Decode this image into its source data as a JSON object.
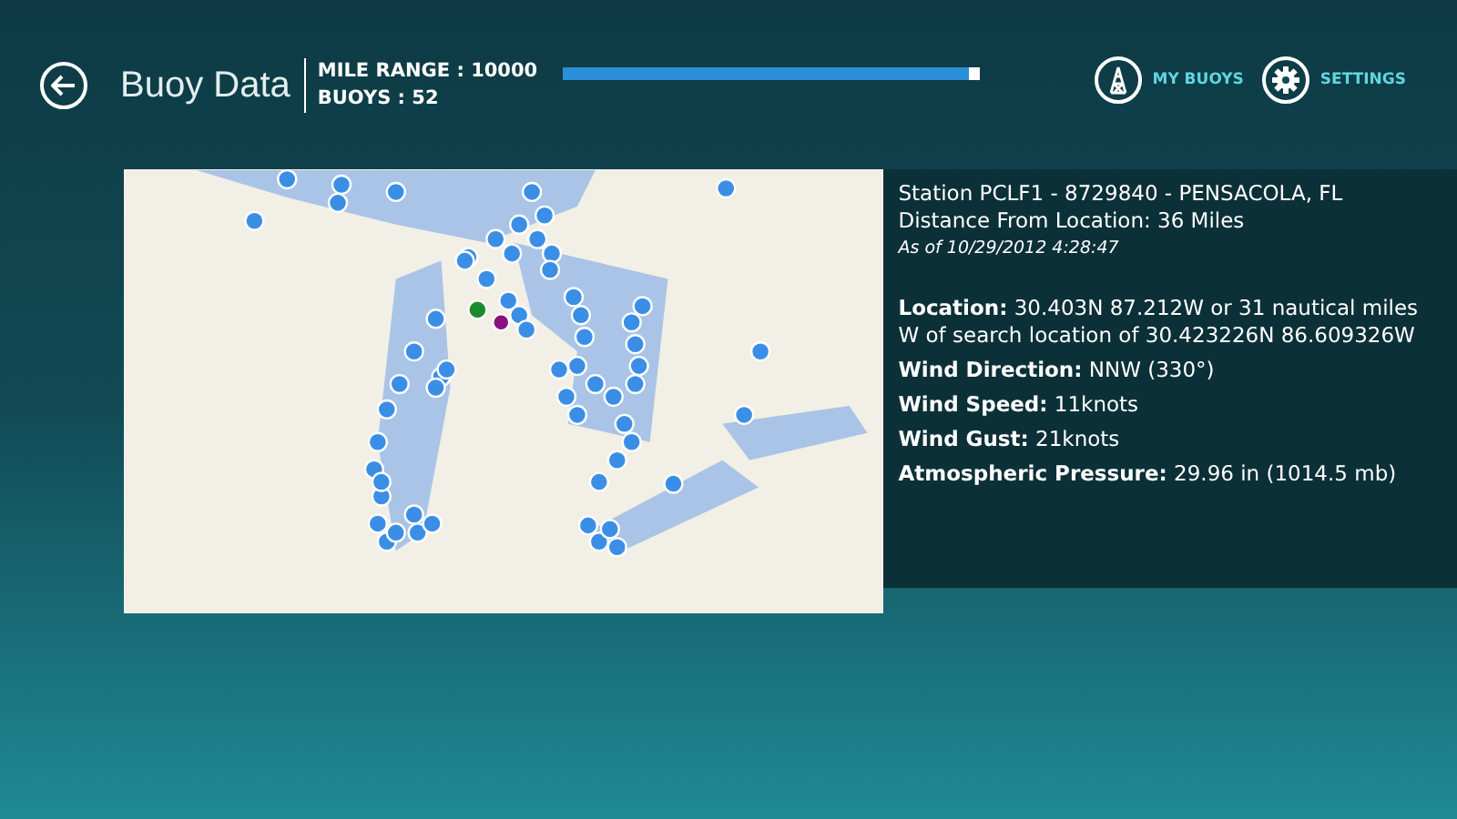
{
  "header": {
    "title": "Buoy Data",
    "mile_range": "MILE RANGE : 10000",
    "buoys": "BUOYS : 52",
    "range_slider": {
      "level": 0.99
    }
  },
  "actions": [
    {
      "kind": "buoy",
      "label": "MY BUOYS"
    },
    {
      "kind": "settings",
      "label": "SETTINGS"
    }
  ],
  "station": {
    "title": "Station PCLF1 - 8729840 - PENSACOLA, FL",
    "distance": "Distance From Location: 36 Miles",
    "timestamp": "As of 10/29/2012 4:28:47",
    "details": [
      "**Location:** 30.403N 87.212W or 31 nautical miles W of search location of 30.423226N 86.609326W",
      "**Wind Direction:** NNW (330°)",
      "**Wind Speed:** 11knots",
      "**Wind Gust:** 21knots",
      "**Atmospheric Pressure:** 29.96 in (1014.5 mb)"
    ]
  }
}
